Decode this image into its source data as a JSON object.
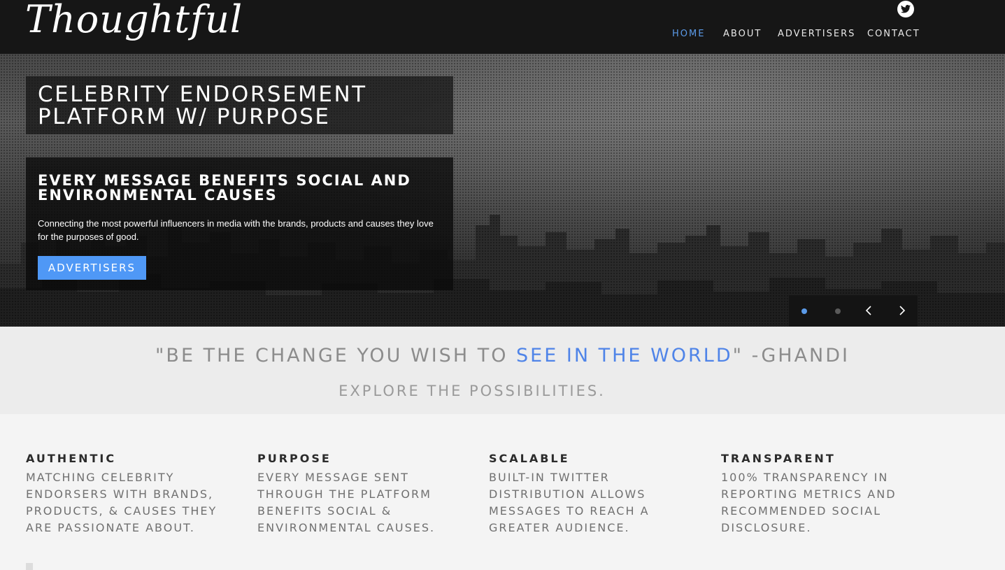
{
  "brand": {
    "logo_text": "Thoughtful"
  },
  "nav": {
    "items": [
      {
        "label": "HOME",
        "active": true
      },
      {
        "label": "ABOUT",
        "active": false
      },
      {
        "label": "ADVERTISERS",
        "active": false
      },
      {
        "label": "CONTACT",
        "active": false
      }
    ],
    "social_icon": "twitter-icon"
  },
  "hero": {
    "title": "CELEBRITY ENDORSEMENT PLATFORM W/ PURPOSE",
    "heading": "EVERY MESSAGE BENEFITS SOCIAL AND ENVIRONMENTAL CAUSES",
    "text": "Connecting the most powerful influencers in media with the brands, products and causes they love for the purposes of good.",
    "cta_label": "ADVERTISERS",
    "slide_count": 2,
    "active_slide": 1
  },
  "quote": {
    "before": "\"BE THE CHANGE YOU WISH TO ",
    "highlight": "SEE IN THE WORLD",
    "after": "\" -GHANDI",
    "subtitle": "EXPLORE THE POSSIBILITIES."
  },
  "features": [
    {
      "title": "AUTHENTIC",
      "text": "MATCHING CELEBRITY ENDORSERS WITH BRANDS, PRODUCTS, & CAUSES THEY ARE PASSIONATE ABOUT."
    },
    {
      "title": "PURPOSE",
      "text": "EVERY MESSAGE SENT THROUGH THE PLATFORM BENEFITS SOCIAL & ENVIRONMENTAL CAUSES."
    },
    {
      "title": "SCALABLE",
      "text": "BUILT-IN TWITTER DISTRIBUTION ALLOWS MESSAGES TO REACH A GREATER AUDIENCE."
    },
    {
      "title": "TRANSPARENT",
      "text": "100% TRANSPARENCY IN REPORTING METRICS AND RECOMMENDED SOCIAL DISCLOSURE."
    }
  ],
  "colors": {
    "accent": "#4f98f6",
    "nav_active": "#5b9ae8",
    "header_bg": "#161616",
    "quote_highlight": "#4f84e8"
  }
}
